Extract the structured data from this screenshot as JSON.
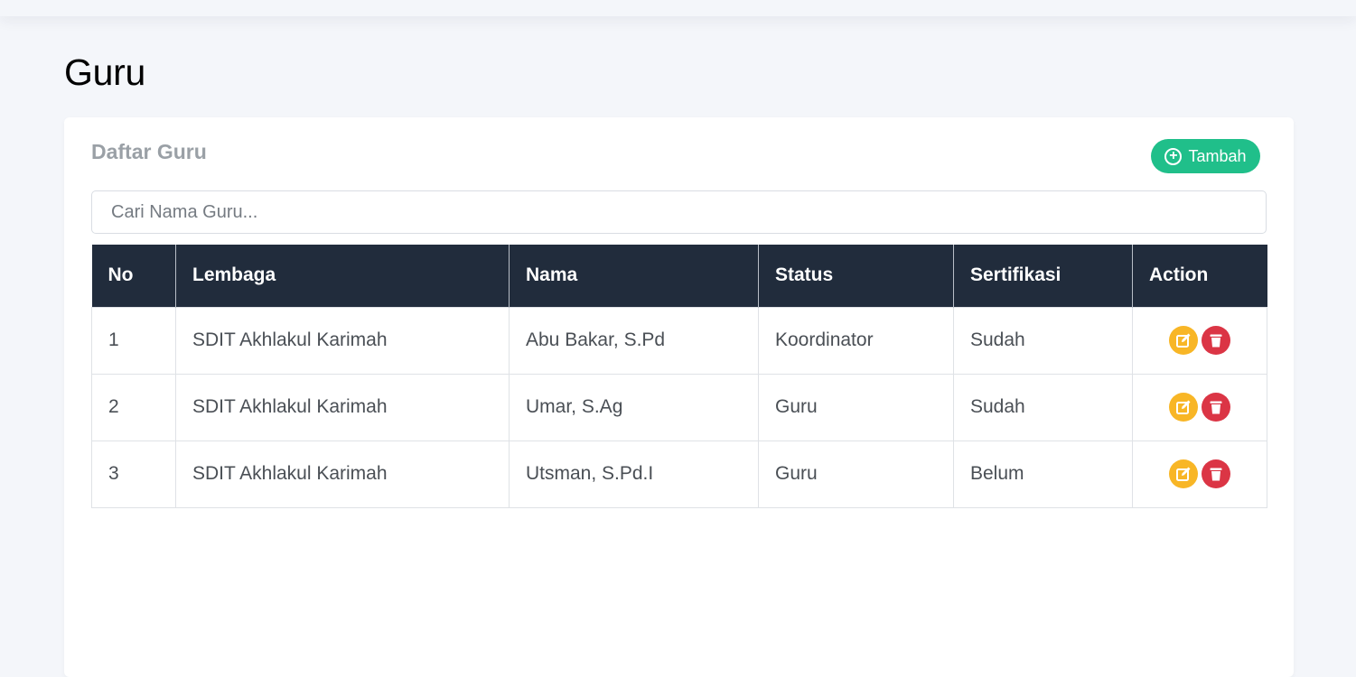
{
  "page": {
    "title": "Guru"
  },
  "card": {
    "title": "Daftar Guru",
    "add_button": {
      "label": "Tambah",
      "icon": "plus-circle-icon"
    }
  },
  "search": {
    "placeholder": "Cari Nama Guru...",
    "value": ""
  },
  "table": {
    "headers": [
      "No",
      "Lembaga",
      "Nama",
      "Status",
      "Sertifikasi",
      "Action"
    ],
    "rows": [
      {
        "no": "1",
        "lembaga": "SDIT Akhlakul Karimah",
        "nama": "Abu Bakar, S.Pd",
        "status": "Koordinator",
        "sertifikasi": "Sudah"
      },
      {
        "no": "2",
        "lembaga": "SDIT Akhlakul Karimah",
        "nama": "Umar, S.Ag",
        "status": "Guru",
        "sertifikasi": "Sudah"
      },
      {
        "no": "3",
        "lembaga": "SDIT Akhlakul Karimah",
        "nama": "Utsman, S.Pd.I",
        "status": "Guru",
        "sertifikasi": "Belum"
      }
    ],
    "action_icons": {
      "edit": "edit-icon",
      "delete": "trash-icon"
    }
  },
  "colors": {
    "header_bg": "#212c3c",
    "add_button": "#20bf8a",
    "edit_button": "#f8b626",
    "delete_button": "#db3545"
  }
}
